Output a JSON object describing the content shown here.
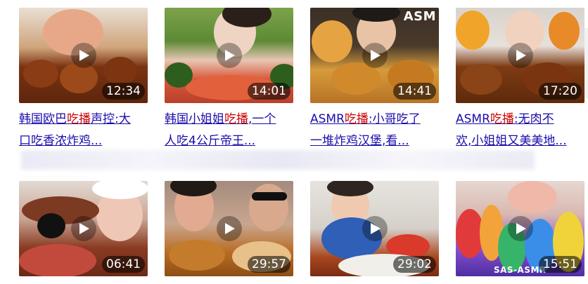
{
  "videos": [
    {
      "title_pre": "韩国欧巴",
      "title_kw": "吃播",
      "title_post": "声控:大",
      "title_line2": "口吃香浓炸鸡...",
      "duration": "12:34",
      "thumb_colors": [
        "#f2e8dc",
        "#7a3312",
        "#b4612b"
      ]
    },
    {
      "title_pre": "韩国小姐姐",
      "title_kw": "吃播",
      "title_post": ",一个",
      "title_line2": "人吃4公斤帝王...",
      "duration": "14:01",
      "thumb_colors": [
        "#3e6f2a",
        "#e0593a",
        "#c93a2a"
      ]
    },
    {
      "title_pre": "ASMR",
      "title_kw": "吃播",
      "title_post": ":小哥吃了",
      "title_line2": "一堆炸鸡汉堡,看...",
      "duration": "14:41",
      "thumb_colors": [
        "#3a2e24",
        "#e2a33d",
        "#c47a26"
      ],
      "watermark": "ASM"
    },
    {
      "title_pre": "ASMR",
      "title_kw": "吃播",
      "title_post": ":无肉不",
      "title_line2": "欢,小姐姐又美美地...",
      "duration": "17:20",
      "thumb_colors": [
        "#d8d2cc",
        "#7d3b13",
        "#f0a52a"
      ]
    },
    {
      "duration": "06:41",
      "thumb_colors": [
        "#dcd3cc",
        "#8a3b22",
        "#c9473a"
      ]
    },
    {
      "duration": "29:57",
      "thumb_colors": [
        "#c9a68f",
        "#b86c22",
        "#e9c089"
      ]
    },
    {
      "duration": "29:02",
      "thumb_colors": [
        "#e0ddd8",
        "#2f5fb6",
        "#d93a2a"
      ]
    },
    {
      "duration": "15:51",
      "thumb_colors": [
        "#e6d7d2",
        "#8a4fd2",
        "#37b46a"
      ],
      "watermark": "SAS-ASMR"
    }
  ]
}
